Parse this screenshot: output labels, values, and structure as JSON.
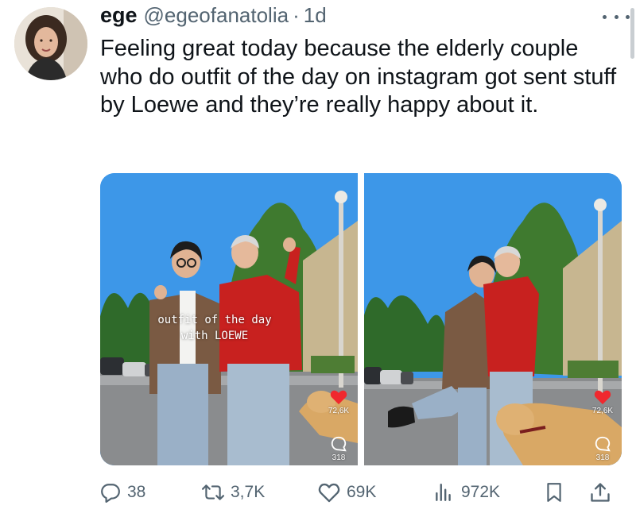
{
  "post": {
    "author_name": "ege",
    "author_handle": "@egeofanatolia",
    "separator": "·",
    "time": "1d",
    "text": "Feeling great today because the elderly couple who do outfit of the day on instagram got sent stuff by Loewe and they’re really happy about it."
  },
  "media": [
    {
      "caption_line1": "outfit of the day",
      "caption_line2": "with LOEWE",
      "likes": "72,6K",
      "comments": "318"
    },
    {
      "likes": "72,6K",
      "comments": "318"
    }
  ],
  "actions": {
    "replies": "38",
    "reposts": "3,7K",
    "likes": "69K",
    "views": "972K"
  },
  "icons": {
    "more": "more-horizontal-icon",
    "reply": "reply-bubble-icon",
    "repost": "repost-icon",
    "like": "heart-outline-icon",
    "views": "bar-chart-icon",
    "bookmark": "bookmark-icon",
    "share": "share-upload-icon"
  },
  "colors": {
    "text": "#0f1419",
    "secondary": "#536471",
    "sky": "#3d97e8",
    "like_red": "#f0282e"
  }
}
